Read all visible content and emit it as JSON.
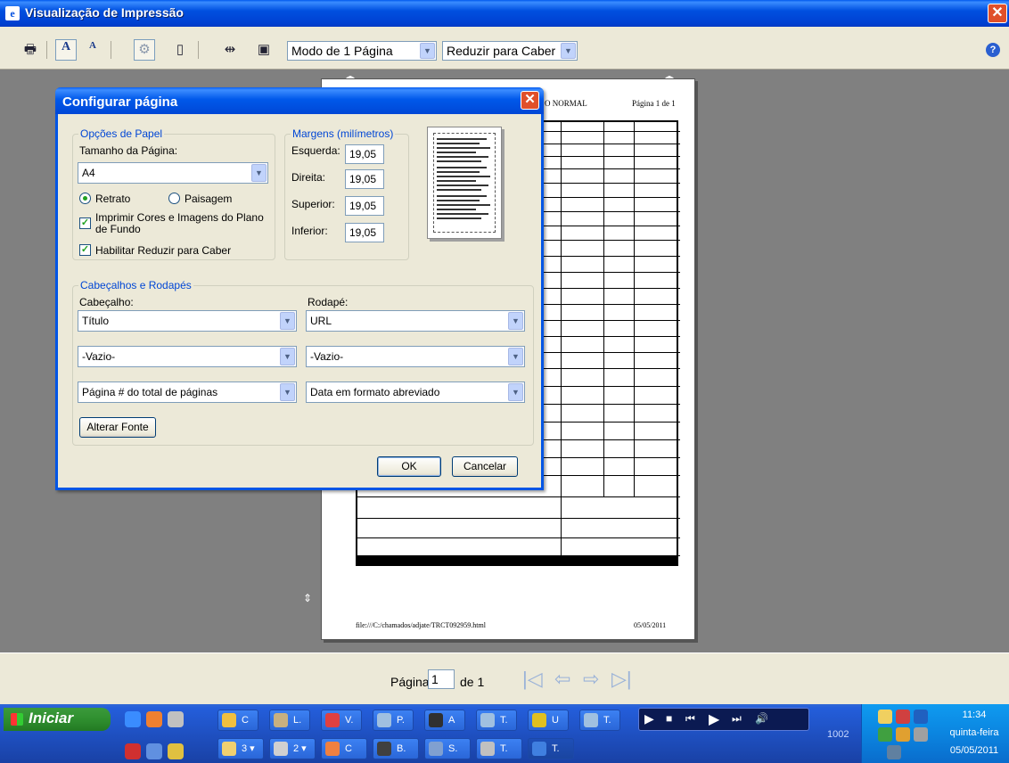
{
  "window": {
    "title": "Visualização de Impressão",
    "close_glyph": "✕"
  },
  "toolbar": {
    "icons": [
      "printer-icon",
      "page-setup-icon",
      "text-size-icon",
      "gear-icon",
      "single-page-icon",
      "fit-width-icon",
      "full-page-icon"
    ],
    "view_mode": "Modo de 1 Página",
    "fit_mode": "Reduzir para Caber",
    "help_glyph": "?"
  },
  "preview": {
    "header_title": "O NORMAL",
    "header_page": "Página 1 de 1",
    "footer_url": "file:///C:/chamados/adjate/TRCT092959.html",
    "footer_date": "05/05/2011"
  },
  "status": {
    "page_label": "Página",
    "page_value": "1",
    "of_label": "de 1"
  },
  "dialog": {
    "title": "Configurar página",
    "paper_group": "Opções de Papel",
    "page_size_label": "Tamanho da Página:",
    "page_size_value": "A4",
    "portrait": "Retrato",
    "landscape": "Paisagem",
    "print_bg": "Imprimir Cores e Imagens do Plano de Fundo",
    "shrink": "Habilitar Reduzir para Caber",
    "margins_group": "Margens (milímetros)",
    "margins": [
      {
        "label": "Esquerda:",
        "value": "19,05"
      },
      {
        "label": "Direita:",
        "value": "19,05"
      },
      {
        "label": "Superior:",
        "value": "19,05"
      },
      {
        "label": "Inferior:",
        "value": "19,05"
      }
    ],
    "hf_group": "Cabeçalhos e Rodapés",
    "header_label": "Cabeçalho:",
    "footer_label": "Rodapé:",
    "header_values": [
      "Título",
      "-Vazio-",
      "Página # do total de páginas"
    ],
    "footer_values": [
      "URL",
      "-Vazio-",
      "Data em formato abreviado"
    ],
    "font_button": "Alterar Fonte",
    "ok": "OK",
    "cancel": "Cancelar"
  },
  "taskbar": {
    "start": "Iniciar",
    "row1": [
      {
        "label": "C",
        "color": "#f0c040"
      },
      {
        "label": "L.",
        "color": "#c8b080"
      },
      {
        "label": "V.",
        "color": "#e04040"
      },
      {
        "label": "P.",
        "color": "#a0c0e0"
      },
      {
        "label": "A",
        "color": "#303030"
      },
      {
        "label": "T.",
        "color": "#a0c0e0"
      },
      {
        "label": "U",
        "color": "#e0c020"
      },
      {
        "label": "T.",
        "color": "#a0c0e0"
      }
    ],
    "row2": [
      {
        "label": "3 ▾",
        "color": "#f0d070"
      },
      {
        "label": "2 ▾",
        "color": "#d0d0d0"
      },
      {
        "label": "C",
        "color": "#f08040"
      },
      {
        "label": "B.",
        "color": "#404040"
      },
      {
        "label": "S.",
        "color": "#80a0d0"
      },
      {
        "label": "T.",
        "color": "#c0c0c0"
      },
      {
        "label": "T.",
        "color": "#4080e0"
      }
    ],
    "num": "1002",
    "time": "11:34",
    "day": "quinta-feira",
    "date": "05/05/2011"
  }
}
